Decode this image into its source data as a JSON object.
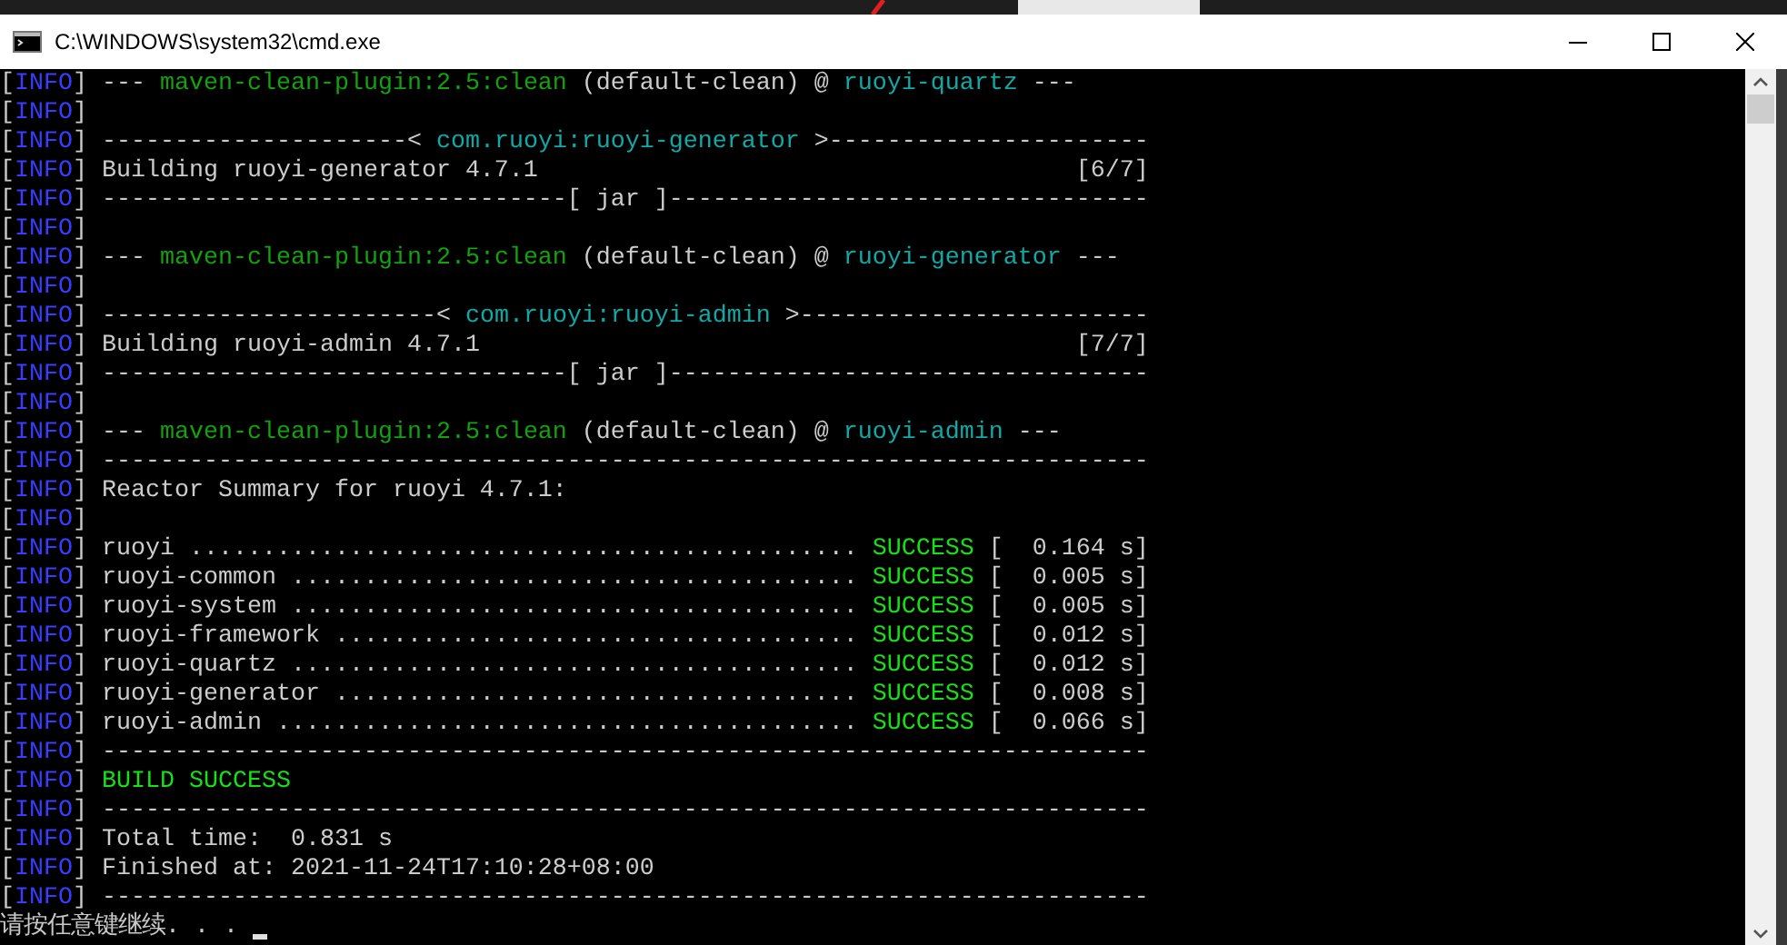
{
  "window": {
    "title": "C:\\WINDOWS\\system32\\cmd.exe"
  },
  "console": {
    "lines": [
      {
        "tag": [
          "[",
          "INFO",
          "]"
        ],
        "segments": [
          {
            "kind": "plain",
            "text": "--- "
          },
          {
            "kind": "plugin",
            "text": "maven-clean-plugin:2.5:clean"
          },
          {
            "kind": "plain",
            "text": " (default-clean) @ "
          },
          {
            "kind": "module",
            "text": "ruoyi-quartz"
          },
          {
            "kind": "plain",
            "text": " ---"
          }
        ]
      },
      {
        "tag": [
          "[",
          "INFO",
          "]"
        ]
      },
      {
        "tag": [
          "[",
          "INFO",
          "]"
        ],
        "segments": [
          {
            "kind": "plain",
            "text": "---------------------< "
          },
          {
            "kind": "module",
            "text": "com.ruoyi:ruoyi-generator"
          },
          {
            "kind": "plain",
            "text": " >----------------------"
          }
        ]
      },
      {
        "tag": [
          "[",
          "INFO",
          "]"
        ],
        "segments": [
          {
            "kind": "plain",
            "text": "Building ruoyi-generator 4.7.1                                     [6/7]"
          }
        ]
      },
      {
        "tag": [
          "[",
          "INFO",
          "]"
        ],
        "segments": [
          {
            "kind": "plain",
            "text": "--------------------------------[ jar ]---------------------------------"
          }
        ]
      },
      {
        "tag": [
          "[",
          "INFO",
          "]"
        ]
      },
      {
        "tag": [
          "[",
          "INFO",
          "]"
        ],
        "segments": [
          {
            "kind": "plain",
            "text": "--- "
          },
          {
            "kind": "plugin",
            "text": "maven-clean-plugin:2.5:clean"
          },
          {
            "kind": "plain",
            "text": " (default-clean) @ "
          },
          {
            "kind": "module",
            "text": "ruoyi-generator"
          },
          {
            "kind": "plain",
            "text": " ---"
          }
        ]
      },
      {
        "tag": [
          "[",
          "INFO",
          "]"
        ]
      },
      {
        "tag": [
          "[",
          "INFO",
          "]"
        ],
        "segments": [
          {
            "kind": "plain",
            "text": "-----------------------< "
          },
          {
            "kind": "module",
            "text": "com.ruoyi:ruoyi-admin"
          },
          {
            "kind": "plain",
            "text": " >------------------------"
          }
        ]
      },
      {
        "tag": [
          "[",
          "INFO",
          "]"
        ],
        "segments": [
          {
            "kind": "plain",
            "text": "Building ruoyi-admin 4.7.1                                         [7/7]"
          }
        ]
      },
      {
        "tag": [
          "[",
          "INFO",
          "]"
        ],
        "segments": [
          {
            "kind": "plain",
            "text": "--------------------------------[ jar ]---------------------------------"
          }
        ]
      },
      {
        "tag": [
          "[",
          "INFO",
          "]"
        ]
      },
      {
        "tag": [
          "[",
          "INFO",
          "]"
        ],
        "segments": [
          {
            "kind": "plain",
            "text": "--- "
          },
          {
            "kind": "plugin",
            "text": "maven-clean-plugin:2.5:clean"
          },
          {
            "kind": "plain",
            "text": " (default-clean) @ "
          },
          {
            "kind": "module",
            "text": "ruoyi-admin"
          },
          {
            "kind": "plain",
            "text": " ---"
          }
        ]
      },
      {
        "tag": [
          "[",
          "INFO",
          "]"
        ],
        "segments": [
          {
            "kind": "plain",
            "text": "------------------------------------------------------------------------"
          }
        ]
      },
      {
        "tag": [
          "[",
          "INFO",
          "]"
        ],
        "segments": [
          {
            "kind": "plain",
            "text": "Reactor Summary for ruoyi 4.7.1:"
          }
        ]
      },
      {
        "tag": [
          "[",
          "INFO",
          "]"
        ]
      },
      {
        "tag": [
          "[",
          "INFO",
          "]"
        ],
        "segments": [
          {
            "kind": "plain",
            "text": "ruoyi .............................................. "
          },
          {
            "kind": "success",
            "text": "SUCCESS"
          },
          {
            "kind": "plain",
            "text": " [  0.164 s]"
          }
        ]
      },
      {
        "tag": [
          "[",
          "INFO",
          "]"
        ],
        "segments": [
          {
            "kind": "plain",
            "text": "ruoyi-common ....................................... "
          },
          {
            "kind": "success",
            "text": "SUCCESS"
          },
          {
            "kind": "plain",
            "text": " [  0.005 s]"
          }
        ]
      },
      {
        "tag": [
          "[",
          "INFO",
          "]"
        ],
        "segments": [
          {
            "kind": "plain",
            "text": "ruoyi-system ....................................... "
          },
          {
            "kind": "success",
            "text": "SUCCESS"
          },
          {
            "kind": "plain",
            "text": " [  0.005 s]"
          }
        ]
      },
      {
        "tag": [
          "[",
          "INFO",
          "]"
        ],
        "segments": [
          {
            "kind": "plain",
            "text": "ruoyi-framework .................................... "
          },
          {
            "kind": "success",
            "text": "SUCCESS"
          },
          {
            "kind": "plain",
            "text": " [  0.012 s]"
          }
        ]
      },
      {
        "tag": [
          "[",
          "INFO",
          "]"
        ],
        "segments": [
          {
            "kind": "plain",
            "text": "ruoyi-quartz ....................................... "
          },
          {
            "kind": "success",
            "text": "SUCCESS"
          },
          {
            "kind": "plain",
            "text": " [  0.012 s]"
          }
        ]
      },
      {
        "tag": [
          "[",
          "INFO",
          "]"
        ],
        "segments": [
          {
            "kind": "plain",
            "text": "ruoyi-generator .................................... "
          },
          {
            "kind": "success",
            "text": "SUCCESS"
          },
          {
            "kind": "plain",
            "text": " [  0.008 s]"
          }
        ]
      },
      {
        "tag": [
          "[",
          "INFO",
          "]"
        ],
        "segments": [
          {
            "kind": "plain",
            "text": "ruoyi-admin ........................................ "
          },
          {
            "kind": "success",
            "text": "SUCCESS"
          },
          {
            "kind": "plain",
            "text": " [  0.066 s]"
          }
        ]
      },
      {
        "tag": [
          "[",
          "INFO",
          "]"
        ],
        "segments": [
          {
            "kind": "plain",
            "text": "------------------------------------------------------------------------"
          }
        ]
      },
      {
        "tag": [
          "[",
          "INFO",
          "]"
        ],
        "segments": [
          {
            "kind": "success",
            "text": "BUILD SUCCESS"
          }
        ]
      },
      {
        "tag": [
          "[",
          "INFO",
          "]"
        ],
        "segments": [
          {
            "kind": "plain",
            "text": "------------------------------------------------------------------------"
          }
        ]
      },
      {
        "tag": [
          "[",
          "INFO",
          "]"
        ],
        "segments": [
          {
            "kind": "plain",
            "text": "Total time:  0.831 s"
          }
        ]
      },
      {
        "tag": [
          "[",
          "INFO",
          "]"
        ],
        "segments": [
          {
            "kind": "plain",
            "text": "Finished at: 2021-11-24T17:10:28+08:00"
          }
        ]
      },
      {
        "tag": [
          "[",
          "INFO",
          "]"
        ],
        "segments": [
          {
            "kind": "plain",
            "text": "------------------------------------------------------------------------"
          }
        ]
      }
    ],
    "prompt": "请按任意键继续. . . "
  }
}
